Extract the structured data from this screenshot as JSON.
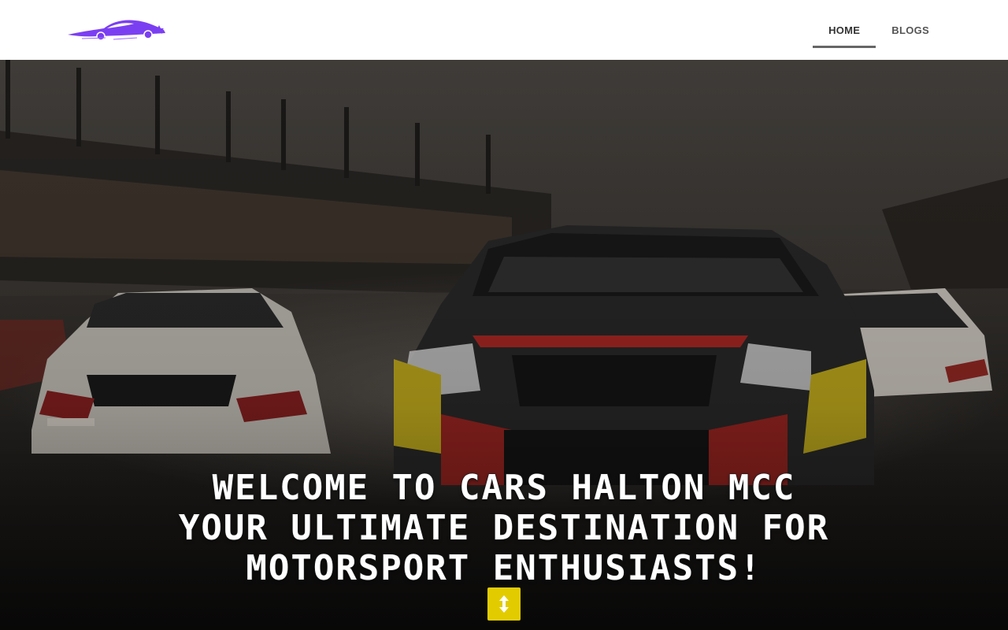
{
  "brand": {
    "logo_icon": "race-car-logo",
    "accent_color": "#7b3ff2"
  },
  "nav": {
    "items": [
      {
        "label": "HOME",
        "active": true
      },
      {
        "label": "BLOGS",
        "active": false
      }
    ]
  },
  "hero": {
    "background_image": "race-cars-on-wet-track",
    "headline_lines": [
      "WELCOME TO CARS HALTON MCC",
      "YOUR ULTIMATE DESTINATION FOR",
      "MOTORSPORT ENTHUSIASTS!"
    ],
    "scroll_button": {
      "icon": "up-down-arrow-icon",
      "color": "#e2cc00"
    }
  }
}
